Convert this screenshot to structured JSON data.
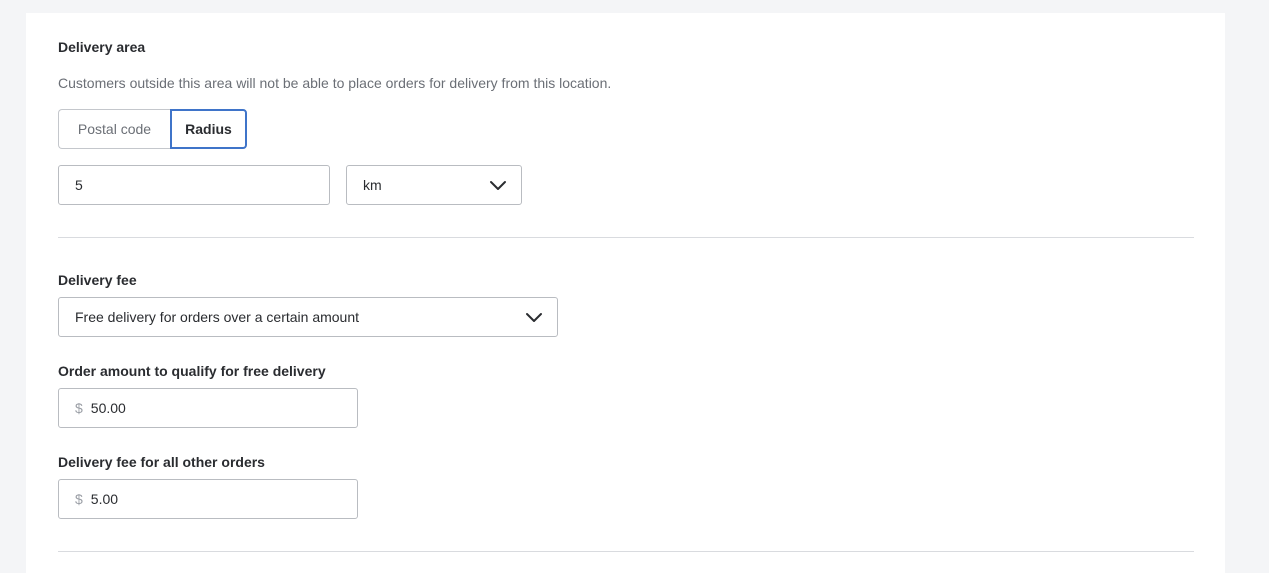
{
  "delivery_area": {
    "title": "Delivery area",
    "helper": "Customers outside this area will not be able to place orders for delivery from this location.",
    "toggle": {
      "options": [
        "Postal code",
        "Radius"
      ],
      "selected": "Radius"
    },
    "radius_value": "5",
    "unit": "km"
  },
  "delivery_fee": {
    "title": "Delivery fee",
    "fee_type": "Free delivery for orders over a certain amount",
    "qualify_label": "Order amount to qualify for free delivery",
    "qualify_currency": "$",
    "qualify_value": "50.00",
    "other_label": "Delivery fee for all other orders",
    "other_currency": "$",
    "other_value": "5.00"
  },
  "colors": {
    "page_bg": "#f4f5f7",
    "card_bg": "#ffffff",
    "accent": "#3f74c9",
    "border": "#b9bcc1"
  },
  "icons": {
    "dropdown": "chevron-down-icon"
  }
}
